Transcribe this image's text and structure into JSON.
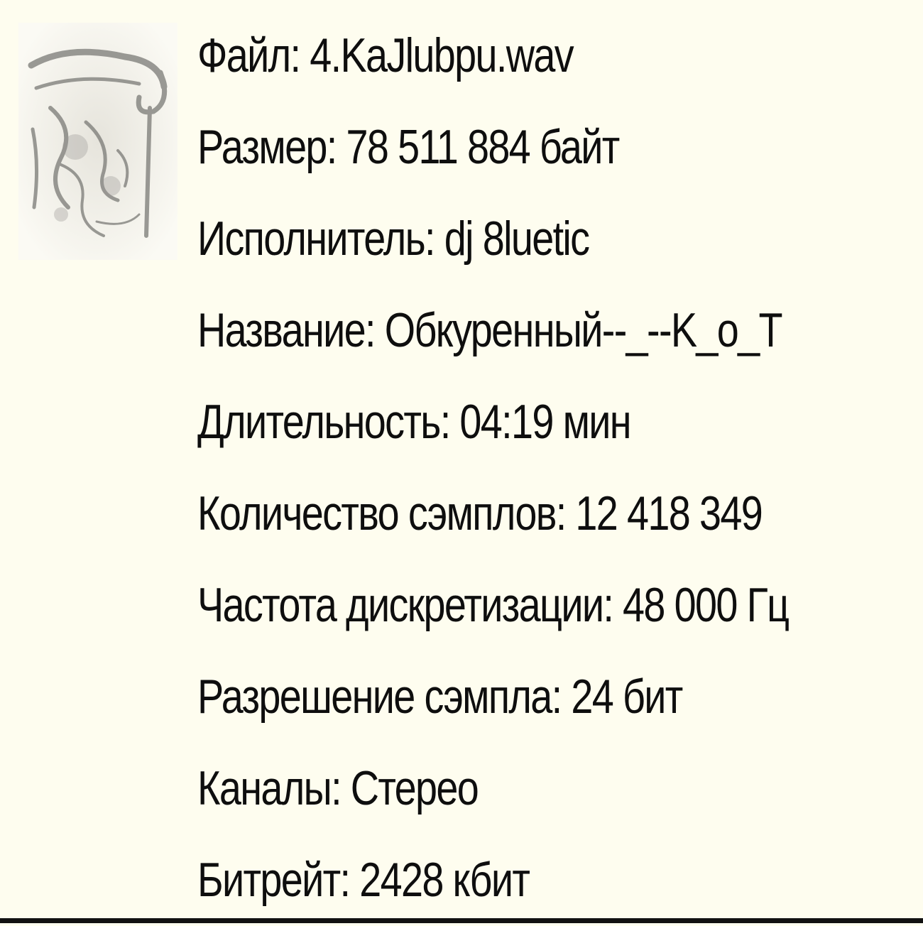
{
  "tooltip": {
    "thumbnail_icon": "audio-file-art-thumbnail",
    "rows": [
      {
        "label": "Файл:",
        "value": "4.KaJlubpu.wav"
      },
      {
        "label": "Размер:",
        "value": "78 511 884 байт"
      },
      {
        "label": "Исполнитель:",
        "value": "dj 8luetic"
      },
      {
        "label": "Название:",
        "value": "Обкуренный--_--K_o_T"
      },
      {
        "label": "Длительность:",
        "value": "04:19 мин"
      },
      {
        "label": "Количество сэмплов:",
        "value": "12 418 349"
      },
      {
        "label": "Частота дискретизации:",
        "value": "48 000 Гц"
      },
      {
        "label": "Разрешение сэмпла:",
        "value": "24 бит"
      },
      {
        "label": "Каналы:",
        "value": "Стерео"
      },
      {
        "label": "Битрейт:",
        "value": "2428 кбит"
      }
    ]
  },
  "colors": {
    "background": "#fefdef",
    "text": "#0e0e0e",
    "bottom_border": "#111111"
  }
}
